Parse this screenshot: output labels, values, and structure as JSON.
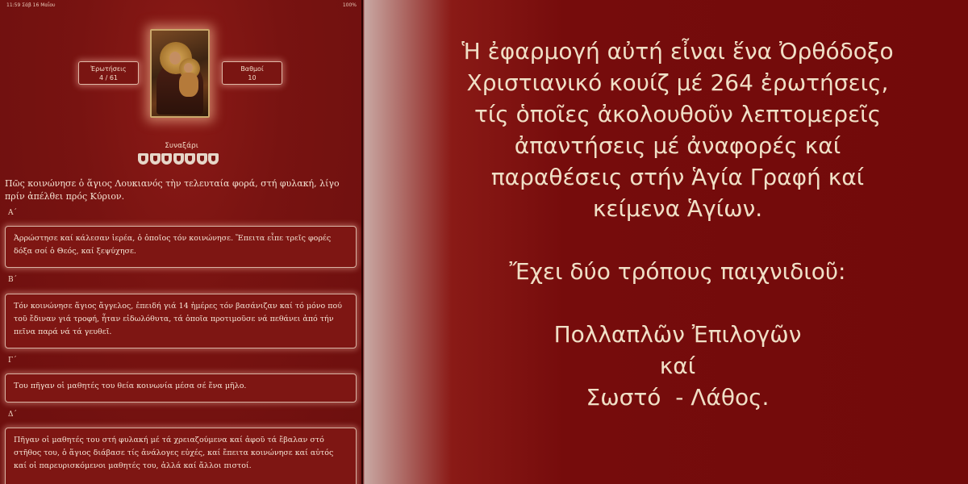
{
  "status_bar": {
    "left": "11:59  Σάβ 16 Μαΐου",
    "right": "100%"
  },
  "stats": {
    "questions_label": "Ἐρωτήσεις",
    "questions_value": "4 / 61",
    "points_label": "Βαθμοί",
    "points_value": "10"
  },
  "category": "Συναξάρι",
  "shields_count": 7,
  "question": "Πῶς κοινώνησε ὁ ἅγιος Λουκιανός τὴν τελευταία φορά, στή φυλακή, λίγο πρίν ἀπέλθει πρός Κύριον.",
  "answers": [
    {
      "label": "Α΄",
      "text": "Ἀρρώστησε καί κάλεσαν ἱερέα, ὁ ὁποῖος τόν κοινώνησε. Ἔπειτα εἶπε τρεῖς φορές δόξα σοί ὁ Θεός, καί ξεψύχησε."
    },
    {
      "label": "Β΄",
      "text": "Τόν κοινώνησε ἅγιος ἄγγελος, ἐπειδή γιά 14 ἡμέρες τόν βασάνιζαν καί τό μόνο πού τοῦ ἔδιναν γιά τροφή, ἦταν εἰδωλόθυτα, τά ὁποῖα προτιμοῦσε νά πεθάνει ἀπό τήν πεῖνα παρά νά τά γευθεῖ."
    },
    {
      "label": "Γ΄",
      "text": "Του πῆγαν οἱ μαθητές του θεία κοινωνία μέσα σέ ἕνα μῆλο."
    },
    {
      "label": "Δ΄",
      "text": "Πῆγαν οἱ μαθητές του στή φυλακή μέ τά χρειαζούμενα καί ἀφοῦ τά ἔβαλαν στό στῆθος του, ὁ ἅγιος διάβασε τίς ἀνάλογες εὐχές, καί ἔπειτα κοινώνησε καί  αὐτός καί οἱ παρευρισκόμενοι μαθητές του, ἀλλά καί ἄλλοι πιστοί."
    }
  ],
  "promo_text": "Ἡ ἐφαρμογή αὐτή εἶναι ἕνα Ὀρθόδοξο\nΧριστιανικό κουίζ μέ 264 ἐρωτήσεις,\nτίς ὁποῖες ἀκολουθοῦν λεπτομερεῖς\nἀπαντήσεις μέ ἀναφορές καί\nπαραθέσεις στήν Ἁγία Γραφή καί\nκείμενα Ἁγίων.\n\nἜχει δύο τρόπους παιχνιδιοῦ:\n\nΠολλαπλῶν Ἐπιλογῶν\nκαί\nΣωστό  - Λάθος.",
  "colors": {
    "background": "#720a0a",
    "text": "#f0dfc6",
    "accent": "#d9b3a4"
  }
}
